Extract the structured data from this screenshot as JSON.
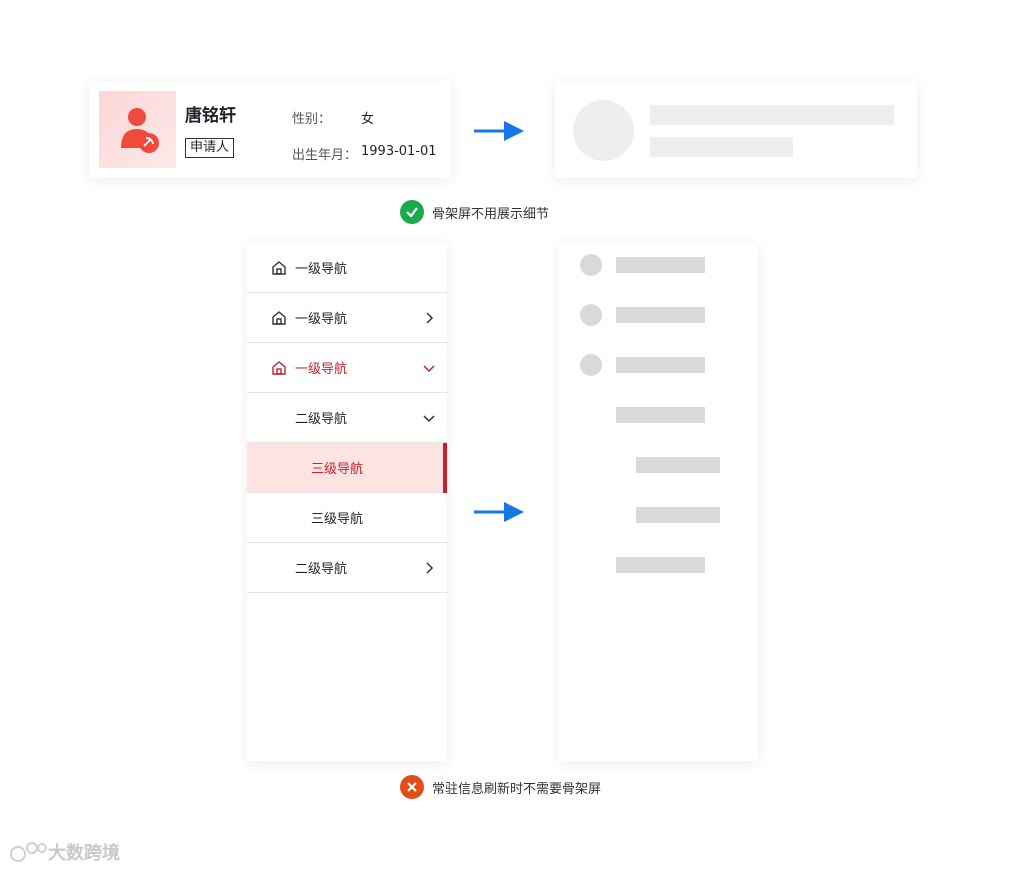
{
  "profile": {
    "name": "唐铭轩",
    "role": "申请人",
    "gender_label": "性别：",
    "gender_value": "女",
    "birth_label": "出生年月：",
    "birth_value": "1993-01-01"
  },
  "notes": {
    "good": "骨架屏不用展示细节",
    "bad": "常驻信息刷新时不需要骨架屏"
  },
  "nav": {
    "items": [
      {
        "label": "一级导航",
        "level": 1,
        "icon": "home-icon"
      },
      {
        "label": "一级导航",
        "level": 1,
        "icon": "home-icon",
        "chevron": "chevron-right-icon"
      },
      {
        "label": "一级导航",
        "level": 1,
        "icon": "home-icon",
        "chevron": "chevron-down-icon",
        "state": "open"
      },
      {
        "label": "二级导航",
        "level": 2,
        "chevron": "chevron-down-icon"
      },
      {
        "label": "三级导航",
        "level": 3,
        "state": "active"
      },
      {
        "label": "三级导航",
        "level": 3
      },
      {
        "label": "二级导航",
        "level": 2,
        "chevron": "chevron-right-icon"
      }
    ]
  },
  "colors": {
    "accent": "#c8202f",
    "active_bg": "#fde3e1",
    "arrow": "#1677e8",
    "good": "#1aab4c",
    "bad": "#e34d16",
    "skeleton": "#eeeeee"
  },
  "watermark": "大数跨境"
}
